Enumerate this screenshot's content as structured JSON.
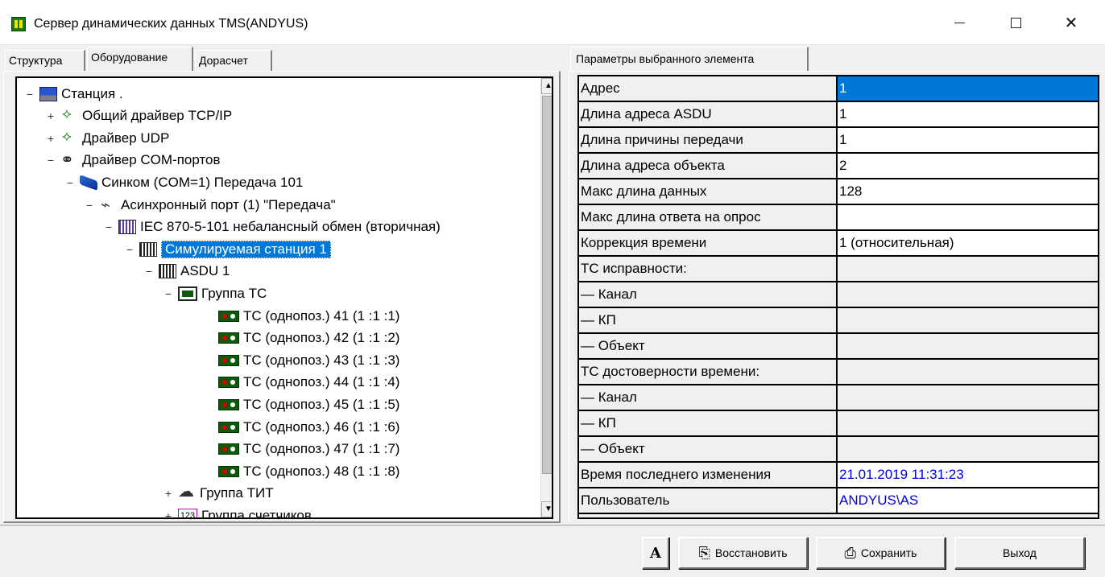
{
  "window": {
    "title": "Сервер динамических данных TMS(ANDYUS)",
    "minimize": "—",
    "maximize": "☐",
    "close": "✕"
  },
  "left_tabs": [
    "Структура",
    "Оборудование",
    "Дорасчет"
  ],
  "right_tab": "Параметры выбранного элемента",
  "tree": [
    {
      "exp": "−",
      "icon": "station-icon",
      "label": "Станция ."
    },
    {
      "exp": "+",
      "icon": "network-driver-icon",
      "label": "Общий драйвер TCP/IP"
    },
    {
      "exp": "+",
      "icon": "network-driver-icon",
      "label": "Драйвер UDP"
    },
    {
      "exp": "−",
      "icon": "com-driver-icon",
      "label": "Драйвер COM-портов"
    },
    {
      "exp": "−",
      "icon": "modem-icon",
      "label": "Синком  (COM=1) Передача 101"
    },
    {
      "exp": "−",
      "icon": "port-icon",
      "label": "Асинхронный порт  (1) \"Передача\""
    },
    {
      "exp": "−",
      "icon": "protocol-icon",
      "label": "IEC 870-5-101 небалансный обмен (вторичная)"
    },
    {
      "exp": "−",
      "icon": "station-rack-icon",
      "label": "Симулируемая станция  1"
    },
    {
      "exp": "−",
      "icon": "asdu-icon",
      "label": "ASDU  1"
    },
    {
      "exp": "−",
      "icon": "ts-group-icon",
      "label": "Группа ТС"
    },
    {
      "exp": "",
      "icon": "ts-icon",
      "label": "ТС (однопоз.)  41 (1 :1 :1)"
    },
    {
      "exp": "",
      "icon": "ts-icon",
      "label": "ТС (однопоз.)  42 (1 :1 :2)"
    },
    {
      "exp": "",
      "icon": "ts-icon",
      "label": "ТС (однопоз.)  43 (1 :1 :3)"
    },
    {
      "exp": "",
      "icon": "ts-icon",
      "label": "ТС (однопоз.)  44 (1 :1 :4)"
    },
    {
      "exp": "",
      "icon": "ts-icon",
      "label": "ТС (однопоз.)  45 (1 :1 :5)"
    },
    {
      "exp": "",
      "icon": "ts-icon",
      "label": "ТС (однопоз.)  46 (1 :1 :6)"
    },
    {
      "exp": "",
      "icon": "ts-icon",
      "label": "ТС (однопоз.)  47 (1 :1 :7)"
    },
    {
      "exp": "",
      "icon": "ts-icon",
      "label": "ТС (однопоз.)  48 (1 :1 :8)"
    },
    {
      "exp": "+",
      "icon": "tit-group-icon",
      "label": "Группа ТИТ"
    },
    {
      "exp": "+",
      "icon": "counter-group-icon",
      "label": "Группа счетчиков"
    }
  ],
  "params": [
    {
      "key": "Адрес",
      "value": "1"
    },
    {
      "key": "Длина адреса ASDU",
      "value": "1"
    },
    {
      "key": "Длина причины передачи",
      "value": "1"
    },
    {
      "key": "Длина адреса объекта",
      "value": "2"
    },
    {
      "key": "Макс длина данных",
      "value": "128"
    },
    {
      "key": "Макс длина ответа на опрос",
      "value": ""
    },
    {
      "key": "Коррекция времени",
      "value": "1 (относительная)"
    },
    {
      "key": "ТС исправности:",
      "value": ""
    },
    {
      "key": "— Канал",
      "value": ""
    },
    {
      "key": "— КП",
      "value": ""
    },
    {
      "key": "— Объект",
      "value": ""
    },
    {
      "key": "ТС достоверности времени:",
      "value": ""
    },
    {
      "key": "— Канал",
      "value": ""
    },
    {
      "key": "— КП",
      "value": ""
    },
    {
      "key": "— Объект",
      "value": ""
    },
    {
      "key": "Время последнего изменения",
      "value": "21.01.2019 11:31:23"
    },
    {
      "key": "Пользователь",
      "value": "ANDYUS\\AS"
    }
  ],
  "buttons": {
    "font": "A",
    "restore": "Восстановить",
    "save": "Сохранить",
    "exit": "Выход"
  },
  "colors": {
    "selection": "#0078d7",
    "value_link": "#0000e0"
  }
}
